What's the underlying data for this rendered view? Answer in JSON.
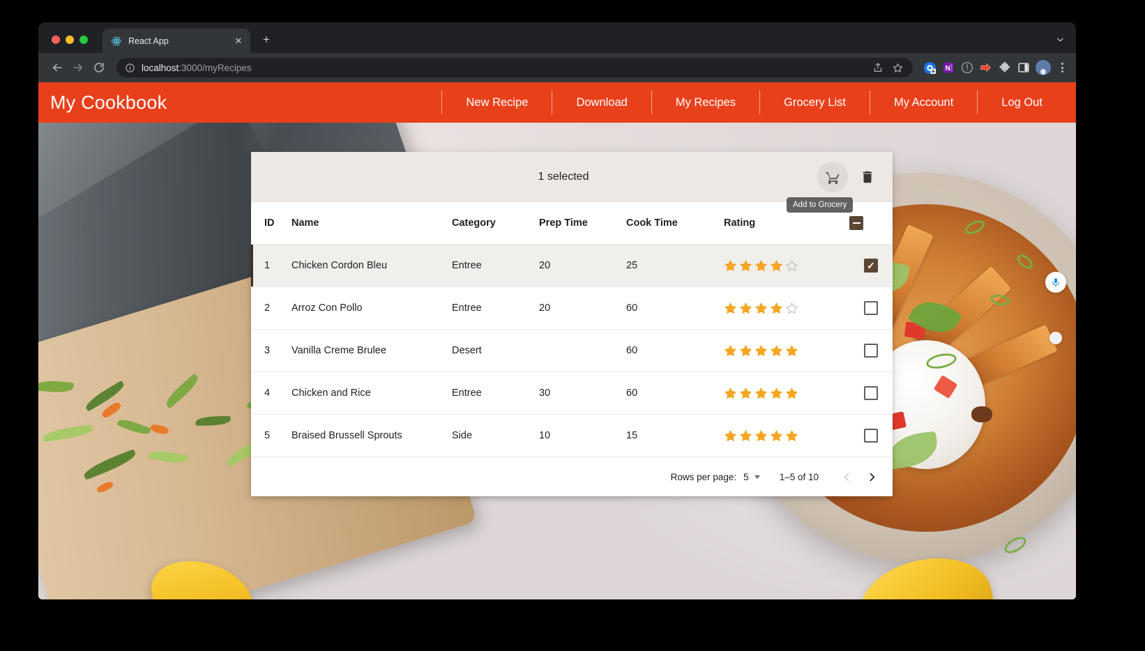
{
  "browser": {
    "tab": {
      "title": "React App",
      "favicon_icon": "react-logo-icon",
      "close_icon": "close-icon"
    },
    "new_tab_icon": "plus-icon",
    "window_chevron_icon": "chevron-down-icon",
    "nav": {
      "back_icon": "arrow-left-icon",
      "forward_icon": "arrow-right-icon",
      "reload_icon": "reload-icon"
    },
    "omnibox": {
      "site_info_icon": "info-circle-icon",
      "url_host": "localhost",
      "url_path": ":3000/myRecipes",
      "share_icon": "share-icon",
      "bookmark_icon": "star-icon"
    },
    "extensions": [
      {
        "name": "blue-circle-extension-icon",
        "color": "#1a73e8"
      },
      {
        "name": "onenote-extension-icon",
        "color": "#7719aa"
      },
      {
        "name": "info-circle-extension-icon",
        "color": "#9aa0a6"
      },
      {
        "name": "red-arrow-extension-icon",
        "color": "#ea4335"
      },
      {
        "name": "puzzle-extensions-icon",
        "color": "#c6c9cc"
      },
      {
        "name": "side-panel-icon",
        "color": "#e8eaed"
      }
    ],
    "profile_avatar_icon": "profile-avatar",
    "menu_icon": "three-dots-menu-icon"
  },
  "app": {
    "title": "My Cookbook",
    "nav_items": [
      {
        "label": "New Recipe",
        "name": "nav-new-recipe"
      },
      {
        "label": "Download",
        "name": "nav-download"
      },
      {
        "label": "My Recipes",
        "name": "nav-my-recipes"
      },
      {
        "label": "Grocery List",
        "name": "nav-grocery-list"
      },
      {
        "label": "My Account",
        "name": "nav-my-account"
      },
      {
        "label": "Log Out",
        "name": "nav-log-out"
      }
    ],
    "brand_color": "#e8401b"
  },
  "table": {
    "toolbar": {
      "selected_text": "1 selected",
      "cart_icon": "shopping-cart-icon",
      "delete_icon": "trash-icon",
      "tooltip": "Add to Grocery"
    },
    "columns": [
      {
        "key": "id",
        "label": "ID"
      },
      {
        "key": "name",
        "label": "Name"
      },
      {
        "key": "category",
        "label": "Category"
      },
      {
        "key": "prep",
        "label": "Prep Time"
      },
      {
        "key": "cook",
        "label": "Cook Time"
      },
      {
        "key": "rating",
        "label": "Rating"
      }
    ],
    "select_all_state": "indeterminate",
    "rows": [
      {
        "id": "1",
        "name": "Chicken Cordon Bleu",
        "category": "Entree",
        "prep": "20",
        "cook": "25",
        "rating": 4,
        "max_rating": 5,
        "selected": true
      },
      {
        "id": "2",
        "name": "Arroz Con Pollo",
        "category": "Entree",
        "prep": "20",
        "cook": "60",
        "rating": 4,
        "max_rating": 5,
        "selected": false
      },
      {
        "id": "3",
        "name": "Vanilla Creme Brulee",
        "category": "Desert",
        "prep": "",
        "cook": "60",
        "rating": 5,
        "max_rating": 5,
        "selected": false
      },
      {
        "id": "4",
        "name": "Chicken and Rice",
        "category": "Entree",
        "prep": "30",
        "cook": "60",
        "rating": 5,
        "max_rating": 5,
        "selected": false
      },
      {
        "id": "5",
        "name": "Braised Brussell Sprouts",
        "category": "Side",
        "prep": "10",
        "cook": "15",
        "rating": 5,
        "max_rating": 5,
        "selected": false
      }
    ],
    "pagination": {
      "rows_per_page_label": "Rows per page:",
      "rows_per_page_value": "5",
      "displayed_rows": "1–5 of 10",
      "prev_icon": "chevron-left-icon",
      "prev_disabled": true,
      "next_icon": "chevron-right-icon",
      "next_disabled": false
    },
    "star_filled_color": "#f5a623",
    "star_empty_color": "#bdbdbd"
  },
  "overlay": {
    "mic_icon": "microphone-icon"
  }
}
